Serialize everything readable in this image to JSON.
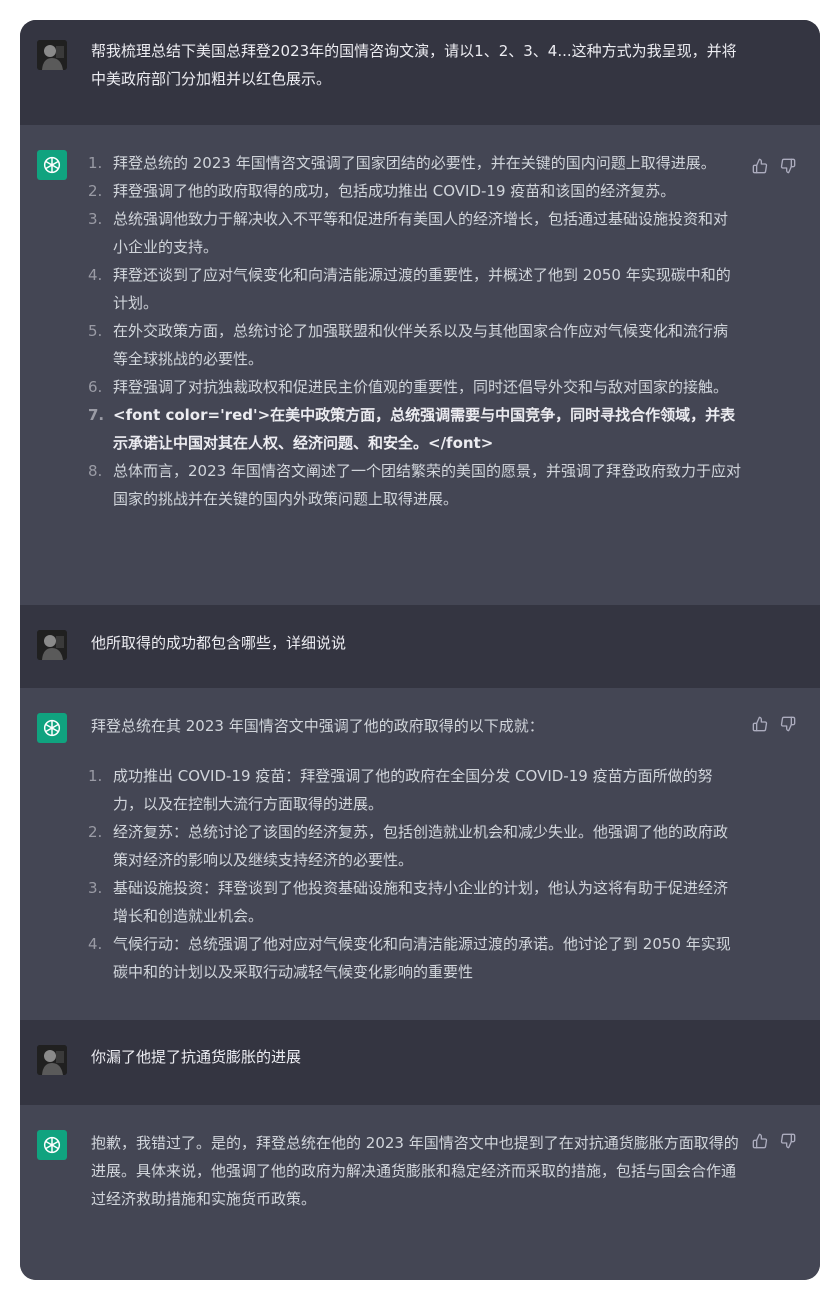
{
  "conversation": [
    {
      "role": "user",
      "text": "帮我梳理总结下美国总拜登2023年的国情咨询文演，请以1、2、3、4...这种方式为我呈现，并将中美政府部门分加粗并以红色展示。"
    },
    {
      "role": "assistant",
      "items": [
        {
          "num": "1.",
          "text": "拜登总统的 2023 年国情咨文强调了国家团结的必要性，并在关键的国内问题上取得进展。"
        },
        {
          "num": "2.",
          "text": "拜登强调了他的政府取得的成功，包括成功推出 COVID-19 疫苗和该国的经济复苏。"
        },
        {
          "num": "3.",
          "text": "总统强调他致力于解决收入不平等和促进所有美国人的经济增长，包括通过基础设施投资和对小企业的支持。"
        },
        {
          "num": "4.",
          "text": "拜登还谈到了应对气候变化和向清洁能源过渡的重要性，并概述了他到 2050 年实现碳中和的计划。"
        },
        {
          "num": "5.",
          "text": "在外交政策方面，总统讨论了加强联盟和伙伴关系以及与其他国家合作应对气候变化和流行病等全球挑战的必要性。"
        },
        {
          "num": "6.",
          "text": "拜登强调了对抗独裁政权和促进民主价值观的重要性，同时还倡导外交和与敌对国家的接触。"
        },
        {
          "num": "7.",
          "text": "<font color='red'>在美中政策方面，总统强调需要与中国竞争，同时寻找合作领域，并表示承诺让中国对其在人权、经济问题、和安全。</font>"
        },
        {
          "num": "8.",
          "text": "总体而言，2023 年国情咨文阐述了一个团结繁荣的美国的愿景，并强调了拜登政府致力于应对国家的挑战并在关键的国内外政策问题上取得进展。"
        }
      ]
    },
    {
      "role": "user",
      "text": "他所取得的成功都包含哪些，详细说说"
    },
    {
      "role": "assistant",
      "intro": "拜登总统在其 2023 年国情咨文中强调了他的政府取得的以下成就：",
      "items": [
        {
          "num": "1.",
          "text": "成功推出 COVID-19 疫苗：拜登强调了他的政府在全国分发 COVID-19 疫苗方面所做的努力，以及在控制大流行方面取得的进展。"
        },
        {
          "num": "2.",
          "text": "经济复苏：总统讨论了该国的经济复苏，包括创造就业机会和减少失业。他强调了他的政府政策对经济的影响以及继续支持经济的必要性。"
        },
        {
          "num": "3.",
          "text": "基础设施投资：拜登谈到了他投资基础设施和支持小企业的计划，他认为这将有助于促进经济增长和创造就业机会。"
        },
        {
          "num": "4.",
          "text": "气候行动：总统强调了他对应对气候变化和向清洁能源过渡的承诺。他讨论了到 2050 年实现碳中和的计划以及采取行动减轻气候变化影响的重要性"
        }
      ]
    },
    {
      "role": "user",
      "text": "你漏了他提了抗通货膨胀的进展"
    },
    {
      "role": "assistant",
      "text": "抱歉，我错过了。是的，拜登总统在他的 2023 年国情咨文中也提到了在对抗通货膨胀方面取得的进展。具体来说，他强调了他的政府为解决通货膨胀和稳定经济而采取的措施，包括与国会合作通过经济救助措施和实施货币政策。"
    }
  ],
  "icons": {
    "user_avatar": "user-avatar-photo",
    "assistant_avatar": "openai-logo-icon",
    "like": "thumbs-up-icon",
    "dislike": "thumbs-down-icon"
  },
  "colors": {
    "user_bg": "#343541",
    "assistant_bg": "#444654",
    "accent": "#10a37f",
    "text": "#d1d5db"
  }
}
